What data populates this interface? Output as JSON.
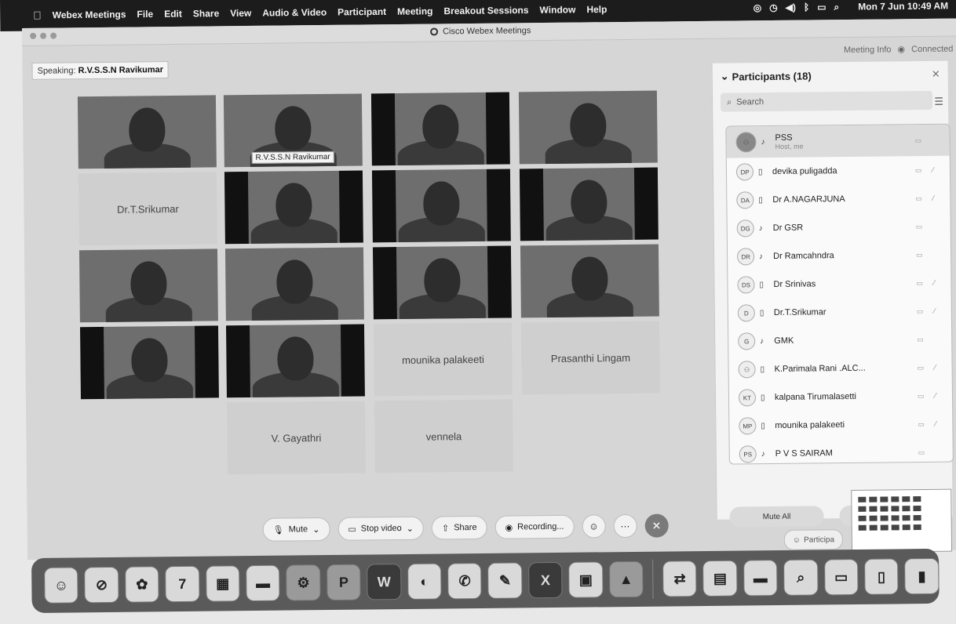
{
  "menubar": {
    "app_name": "Webex Meetings",
    "items": [
      "File",
      "Edit",
      "Share",
      "View",
      "Audio & Video",
      "Participant",
      "Meeting",
      "Breakout Sessions",
      "Window",
      "Help"
    ],
    "clock": "Mon 7 Jun  10:49 AM"
  },
  "window": {
    "title": "Cisco Webex Meetings",
    "meeting_info": "Meeting Info",
    "connected": "Connected"
  },
  "speaking": {
    "label": "Speaking:",
    "name": "R.V.S.S.N Ravikumar"
  },
  "tiles": [
    {
      "name": "",
      "video": true,
      "bars": false
    },
    {
      "name": "",
      "video": true,
      "bars": false,
      "tag": "R.V.S.S.N Ravikumar"
    },
    {
      "name": "",
      "video": true,
      "bars": true
    },
    {
      "name": "",
      "video": true,
      "bars": false
    },
    {
      "name": "Dr.T.Srikumar",
      "video": false
    },
    {
      "name": "",
      "video": true,
      "bars": true
    },
    {
      "name": "",
      "video": true,
      "bars": true
    },
    {
      "name": "",
      "video": true,
      "bars": true
    },
    {
      "name": "",
      "video": true,
      "bars": false
    },
    {
      "name": "",
      "video": true,
      "bars": false
    },
    {
      "name": "",
      "video": true,
      "bars": true
    },
    {
      "name": "",
      "video": true,
      "bars": false
    },
    {
      "name": "",
      "video": true,
      "bars": true
    },
    {
      "name": "",
      "video": true,
      "bars": true
    },
    {
      "name": "mounika palakeeti",
      "video": false
    },
    {
      "name": "Prasanthi Lingam",
      "video": false
    },
    {
      "name": "V. Gayathri",
      "video": false
    },
    {
      "name": "vennela",
      "video": false
    }
  ],
  "panel": {
    "title": "Participants (18)",
    "search_placeholder": "Search",
    "participants": [
      {
        "initials": "",
        "name": "PSS",
        "sub": "Host, me",
        "device": "mic"
      },
      {
        "initials": "DP",
        "name": "devika puligadda",
        "sub": "",
        "device": "phone"
      },
      {
        "initials": "DA",
        "name": "Dr A.NAGARJUNA",
        "sub": "",
        "device": "phone"
      },
      {
        "initials": "DG",
        "name": "Dr GSR",
        "sub": "",
        "device": "mic"
      },
      {
        "initials": "DR",
        "name": "Dr Ramcahndra",
        "sub": "",
        "device": "mic"
      },
      {
        "initials": "DS",
        "name": "Dr Srinivas",
        "sub": "",
        "device": "phone"
      },
      {
        "initials": "D",
        "name": "Dr.T.Srikumar",
        "sub": "",
        "device": "phone"
      },
      {
        "initials": "G",
        "name": "GMK",
        "sub": "",
        "device": "mic"
      },
      {
        "initials": "",
        "name": "K.Parimala Rani .ALC...",
        "sub": "",
        "device": "phone"
      },
      {
        "initials": "KT",
        "name": "kalpana Tirumalasetti",
        "sub": "",
        "device": "phone"
      },
      {
        "initials": "MP",
        "name": "mounika palakeeti",
        "sub": "",
        "device": "phone"
      },
      {
        "initials": "PS",
        "name": "P V S SAIRAM",
        "sub": "",
        "device": "mic"
      }
    ],
    "mute_all": "Mute All"
  },
  "controls": {
    "mute": "Mute",
    "stop_video": "Stop video",
    "share": "Share",
    "recording": "Recording...",
    "participants": "Participa"
  },
  "dock": {
    "calendar_day": "7"
  }
}
